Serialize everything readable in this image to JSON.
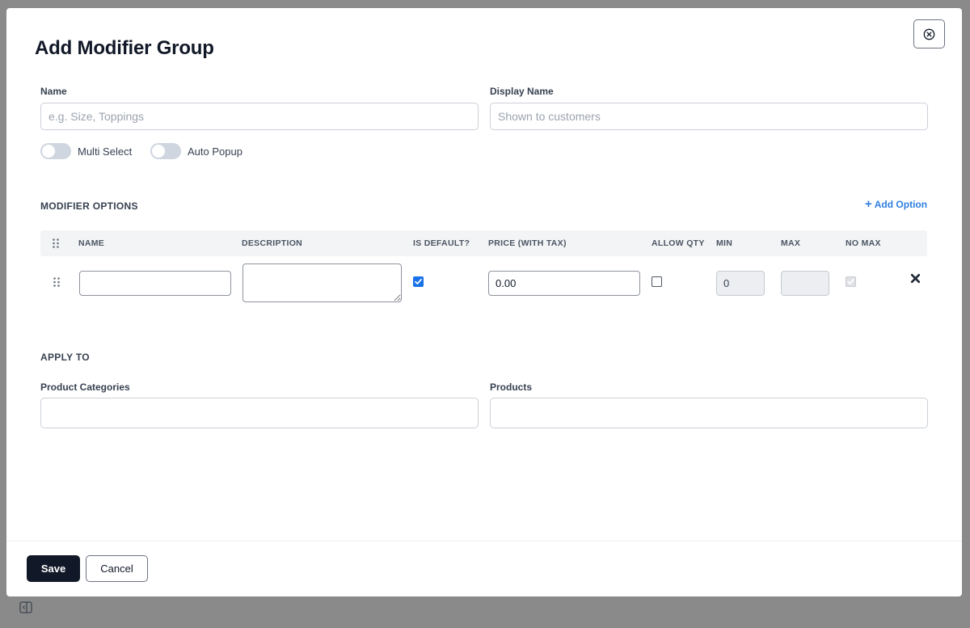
{
  "modal": {
    "title": "Add Modifier Group"
  },
  "fields": {
    "name_label": "Name",
    "name_placeholder": "e.g. Size, Toppings",
    "display_name_label": "Display Name",
    "display_name_placeholder": "Shown to customers"
  },
  "toggles": {
    "multi_select": {
      "label": "Multi Select",
      "on": false
    },
    "auto_popup": {
      "label": "Auto Popup",
      "on": false
    }
  },
  "modifier_options": {
    "section_title": "MODIFIER OPTIONS",
    "add_option_label": "Add Option",
    "columns": {
      "name": "NAME",
      "description": "DESCRIPTION",
      "is_default": "IS DEFAULT?",
      "price": "PRICE (WITH TAX)",
      "allow_qty": "ALLOW QTY",
      "min": "MIN",
      "max": "MAX",
      "no_max": "NO MAX"
    },
    "rows": [
      {
        "name": "",
        "description": "",
        "is_default": true,
        "price": "0.00",
        "allow_qty": false,
        "min": "0",
        "max": "",
        "no_max": true
      }
    ]
  },
  "apply_to": {
    "section_title": "APPLY TO",
    "product_categories_label": "Product Categories",
    "products_label": "Products"
  },
  "footer": {
    "save_label": "Save",
    "cancel_label": "Cancel"
  },
  "colors": {
    "accent": "#1a73e8",
    "link": "#2f7fe0",
    "primary_button": "#111827",
    "overlay": "#8a8a8a"
  }
}
